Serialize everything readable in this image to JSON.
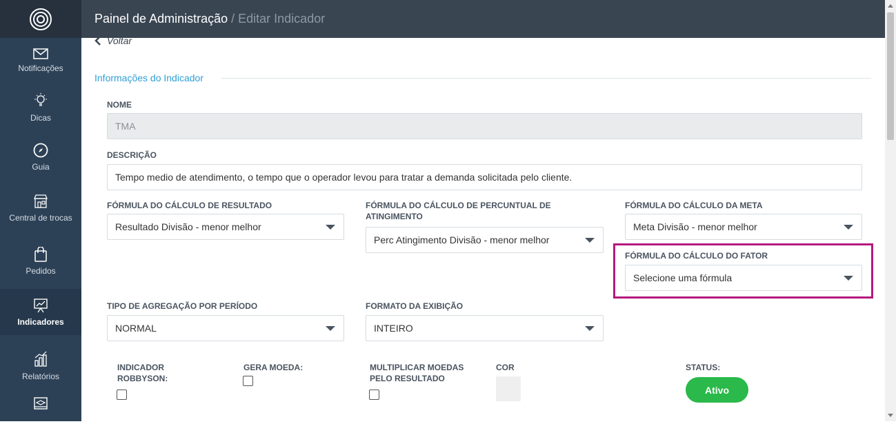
{
  "header": {
    "title": "Painel de Administração",
    "separator": "/",
    "current": "Editar Indicador"
  },
  "sidebar": {
    "items": [
      {
        "label": "Notificações",
        "icon": "envelope-icon"
      },
      {
        "label": "Dicas",
        "icon": "lightbulb-icon"
      },
      {
        "label": "Guia",
        "icon": "compass-icon"
      },
      {
        "label": "Central de trocas",
        "icon": "store-icon"
      },
      {
        "label": "Pedidos",
        "icon": "shopping-bag-icon"
      },
      {
        "label": "Indicadores",
        "icon": "presentation-chart-icon",
        "active": true
      },
      {
        "label": "Relatórios",
        "icon": "bar-chart-icon"
      }
    ]
  },
  "back_label": "Voltar",
  "section_title": "Informações do Indicador",
  "form": {
    "nome_label": "NOME",
    "nome_value": "TMA",
    "descricao_label": "DESCRIÇÃO",
    "descricao_value": "Tempo medio de atendimento, o tempo que o operador levou para tratar a demanda solicitada pelo cliente.",
    "formula_resultado_label": "FÓRMULA DO CÁLCULO DE RESULTADO",
    "formula_resultado_value": "Resultado Divisão - menor melhor",
    "formula_percentual_label": "FÓRMULA DO CÁLCULO DE PERCUNTUAL DE ATINGIMENTO",
    "formula_percentual_value": "Perc Atingimento Divisão - menor melhor",
    "formula_meta_label": "FÓRMULA DO CÁLCULO DA META",
    "formula_meta_value": "Meta Divisão - menor melhor",
    "formula_fator_label": "FÓRMULA DO CÁLCULO DO FATOR",
    "formula_fator_value": "Selecione uma fórmula",
    "tipo_agregacao_label": "TIPO DE AGREGAÇÃO POR PERÍODO",
    "tipo_agregacao_value": "NORMAL",
    "formato_exibicao_label": "FORMATO DA EXIBIÇÃO",
    "formato_exibicao_value": "INTEIRO",
    "indicador_robbyson_label": "INDICADOR ROBBYSON:",
    "gera_moeda_label": "GERA MOEDA:",
    "multiplicar_moedas_label": "MULTIPLICAR MOEDAS PELO RESULTADO",
    "cor_label": "COR",
    "status_label": "STATUS:",
    "status_value": "Ativo"
  },
  "colors": {
    "accent": "#2f9fd6",
    "highlight": "#b5197d",
    "status_active": "#2ab94a",
    "sidebar": "#2d4156",
    "topbar": "#3a4552"
  }
}
